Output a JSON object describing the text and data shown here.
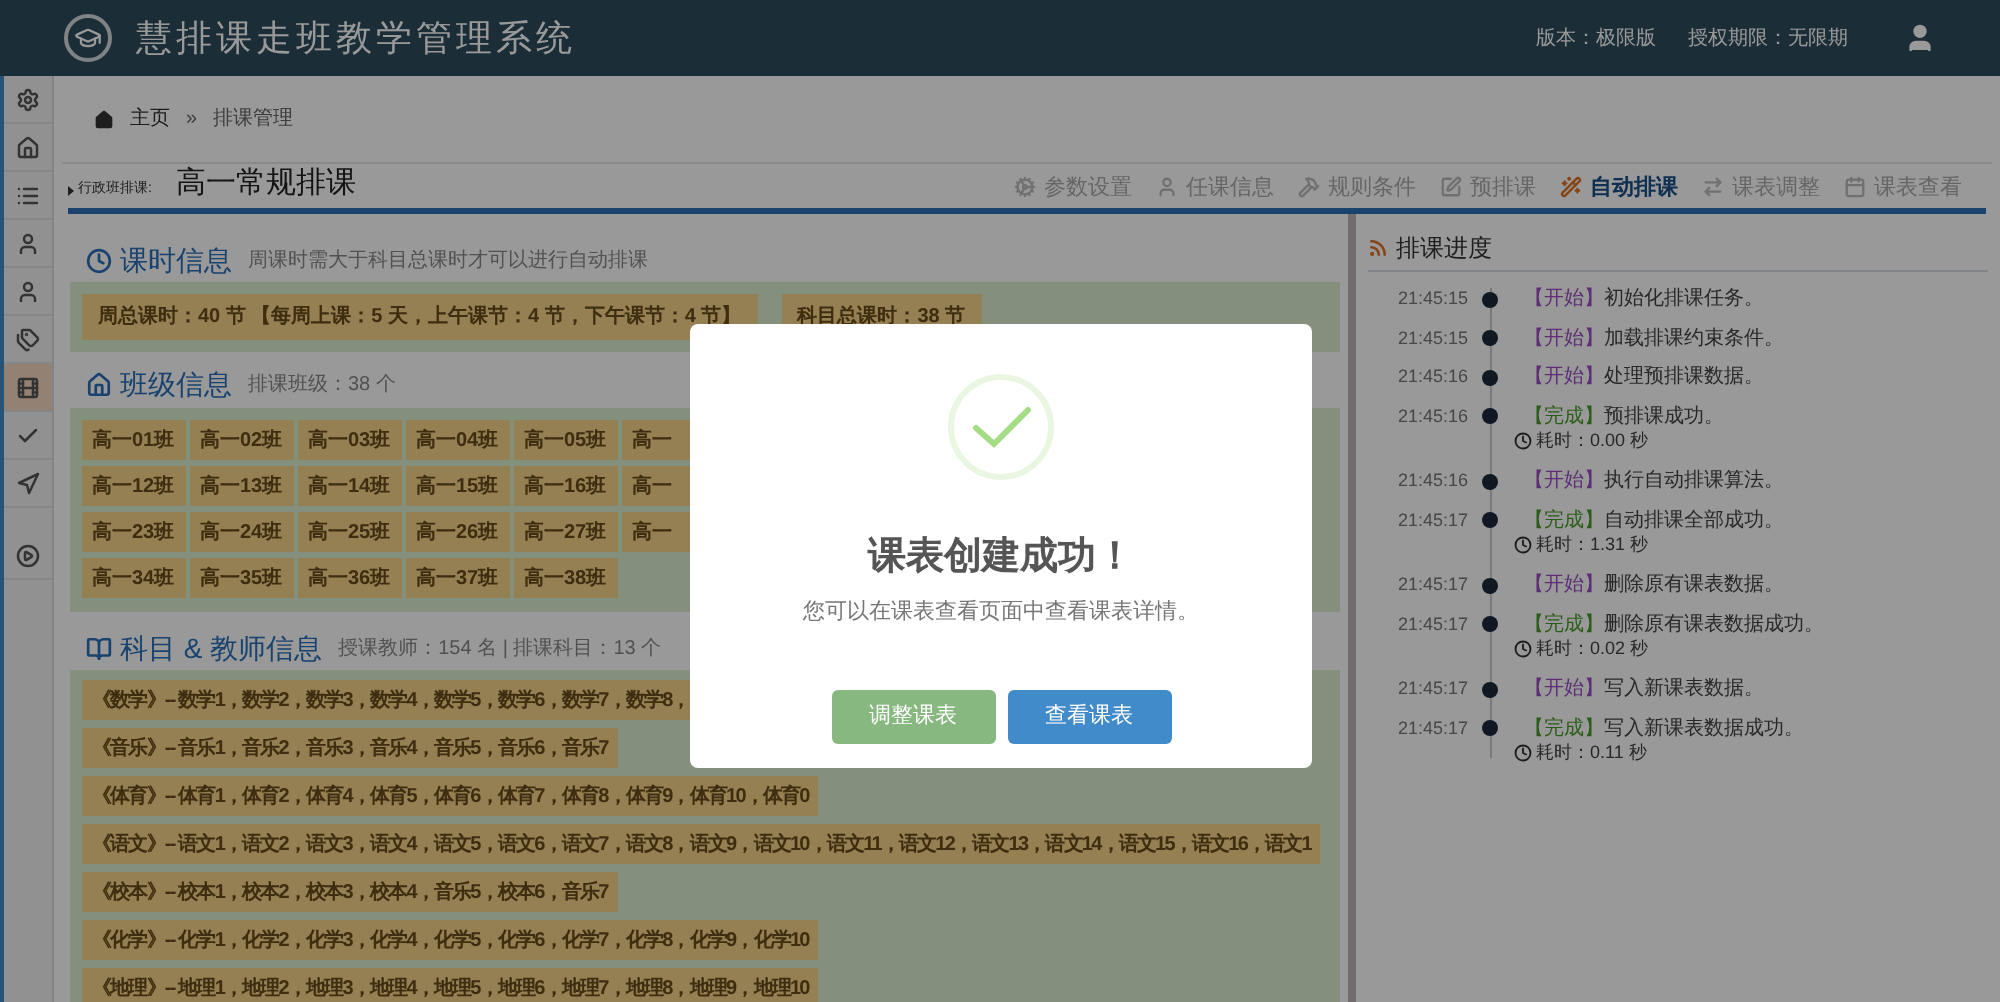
{
  "header": {
    "title": "慧排课走班教学管理系统",
    "version": "版本：极限版",
    "license": "授权期限：无限期"
  },
  "sidebar": {
    "items": [
      {
        "selected": false
      },
      {
        "selected": false
      },
      {
        "selected": false
      },
      {
        "selected": false
      },
      {
        "selected": false
      },
      {
        "selected": false
      },
      {
        "selected": true
      },
      {
        "selected": false
      },
      {
        "selected": false
      },
      {
        "selected": false
      }
    ]
  },
  "breadcrumb": [
    "主页",
    "»",
    "排课管理"
  ],
  "page": {
    "label": "行政班排课:",
    "title": "高一常规排课"
  },
  "steps": [
    {
      "label": "参数设置",
      "selected": false
    },
    {
      "label": "任课信息",
      "selected": false
    },
    {
      "label": "规则条件",
      "selected": false
    },
    {
      "label": "预排课",
      "selected": false
    },
    {
      "label": "自动排课",
      "selected": true
    },
    {
      "label": "课表调整",
      "selected": false
    },
    {
      "label": "课表查看",
      "selected": false
    }
  ],
  "hours": {
    "title": "课时信息",
    "note": "周课时需大于科目总课时才可以进行自动排课",
    "tiles": [
      "周总课时：40 节 【每周上课：5 天，上午课节：4 节，下午课节：4 节】",
      "科目总课时：38 节"
    ]
  },
  "classes": {
    "title": "班级信息",
    "note": "排课班级：38 个",
    "rows": [
      [
        "高一01班",
        "高一02班",
        "高一03班",
        "高一04班",
        "高一05班",
        "高一"
      ],
      [
        "高一12班",
        "高一13班",
        "高一14班",
        "高一15班",
        "高一16班",
        "高一"
      ],
      [
        "高一23班",
        "高一24班",
        "高一25班",
        "高一26班",
        "高一27班",
        "高一"
      ],
      [
        "高一34班",
        "高一35班",
        "高一36班",
        "高一37班",
        "高一38班"
      ]
    ]
  },
  "subjects": {
    "title": "科目 & 教师信息",
    "note": "授课教师：154 名 | 排课科目：13 个",
    "rows": [
      "《数学》-- 数学1，数学2，数学3，数学4，数学5，数学6，数学7，数学8，",
      "《音乐》-- 音乐1，音乐2，音乐3，音乐4，音乐5，音乐6，音乐7",
      "《体育》-- 体育1，体育2，体育4，体育5，体育6，体育7，体育8，体育9，体育10，体育0",
      "《语文》-- 语文1，语文2，语文3，语文4，语文5，语文6，语文7，语文8，语文9，语文10，语文11，语文12，语文13，语文14，语文15，语文16，语文1",
      "《校本》-- 校本1，校本2，校本3，校本4，音乐5，校本6，音乐7",
      "《化学》-- 化学1，化学2，化学3，化学4，化学5，化学6，化学7，化学8，化学9，化学10",
      "《地理》-- 地理1，地理2，地理3，地理4，地理5，地理6，地理7，地理8，地理9，地理10"
    ]
  },
  "progress": {
    "title": "排课进度",
    "entries": [
      {
        "time": "21:45:15",
        "kind": "start",
        "tag": "【开始】",
        "text": "初始化排课任务。"
      },
      {
        "time": "21:45:15",
        "kind": "start",
        "tag": "【开始】",
        "text": "加载排课约束条件。"
      },
      {
        "time": "21:45:16",
        "kind": "start",
        "tag": "【开始】",
        "text": "处理预排课数据。"
      },
      {
        "time": "21:45:16",
        "kind": "done",
        "tag": "【完成】",
        "text": "预排课成功。",
        "duration": "耗时：0.00 秒"
      },
      {
        "time": "21:45:16",
        "kind": "start",
        "tag": "【开始】",
        "text": "执行自动排课算法。"
      },
      {
        "time": "21:45:17",
        "kind": "done",
        "tag": "【完成】",
        "text": "自动排课全部成功。",
        "duration": "耗时：1.31 秒"
      },
      {
        "time": "21:45:17",
        "kind": "start",
        "tag": "【开始】",
        "text": "删除原有课表数据。"
      },
      {
        "time": "21:45:17",
        "kind": "done",
        "tag": "【完成】",
        "text": "删除原有课表数据成功。",
        "duration": "耗时：0.02 秒"
      },
      {
        "time": "21:45:17",
        "kind": "start",
        "tag": "【开始】",
        "text": "写入新课表数据。"
      },
      {
        "time": "21:45:17",
        "kind": "done",
        "tag": "【完成】",
        "text": "写入新课表数据成功。",
        "duration": "耗时：0.11 秒"
      }
    ]
  },
  "dialog": {
    "title": "课表创建成功！",
    "message": "您可以在课表查看页面中查看课表详情。",
    "buttons": [
      {
        "label": "调整课表",
        "kind": "secondary"
      },
      {
        "label": "查看课表",
        "kind": "primary"
      }
    ]
  }
}
